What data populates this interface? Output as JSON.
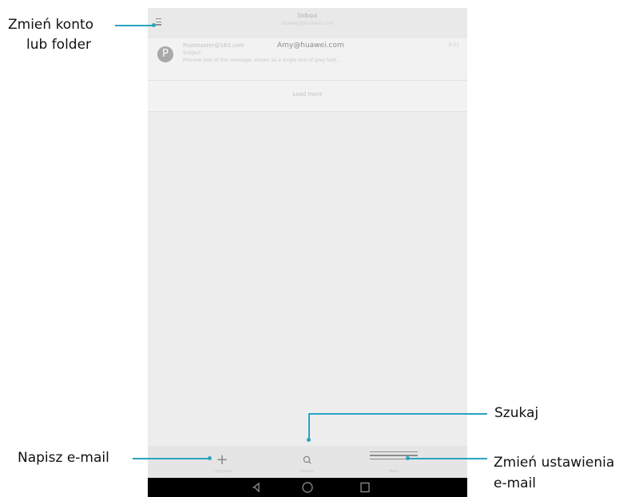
{
  "phone": {
    "header": {
      "title": "Inbox",
      "account": "Huawei@huawei.com"
    },
    "mail": {
      "avatar_letter": "P",
      "sender": "Postmaster@163.com",
      "recipient": "Amy@huawei.com",
      "time": "9:51",
      "subject": "Subject",
      "snippet": "Preview text of the message, shown as a single line of grey text..."
    },
    "load_more": "Load more",
    "bottom_bar": {
      "compose_label": "Compose",
      "search_label": "Search",
      "more_label": "More"
    }
  },
  "callouts": {
    "switch_account_line1": "Zmień konto",
    "switch_account_line2": "lub folder",
    "search": "Szukaj",
    "compose": "Napisz e-mail",
    "settings_line1": "Zmień ustawienia",
    "settings_line2": "e-mail"
  },
  "colors": {
    "callout_line": "#2aa3c2",
    "screen_bg": "#ededed",
    "nav_bar": "#000000"
  },
  "icons": [
    "menu-icon",
    "plus-icon",
    "search-icon",
    "more-menu-icon",
    "back-icon",
    "home-icon",
    "recents-icon"
  ]
}
